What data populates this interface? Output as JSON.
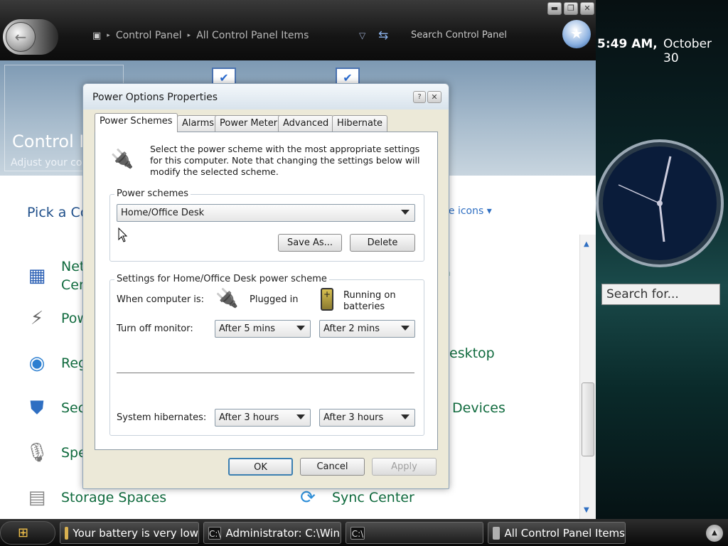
{
  "window": {
    "breadcrumb": [
      "Control Panel",
      "All Control Panel Items"
    ],
    "search_placeholder": "Search Control Panel",
    "banner_title": "Control P",
    "banner_subtitle": "Adjust your cor",
    "pick_title": "Pick a Co",
    "view_by": "ge icons ▾",
    "left_items": [
      "Net\nCen",
      "Pow",
      "Reg",
      "Sec",
      "Spe",
      "Storage Spaces"
    ],
    "left_items_display": {
      "net1": "Net",
      "net2": "Cen",
      "pow": "Pow",
      "reg": "Reg",
      "sec": "Sec",
      "spe": "Spe",
      "storage": "Storage Spaces"
    },
    "right_items": {
      "desktop": "esktop",
      "devices": "Devices",
      "sync": "Sync Center",
      "partial": "a"
    },
    "controls": {
      "minimize": "▬",
      "restore": "❐",
      "close": "✕"
    }
  },
  "sidebar": {
    "time": "5:49 AM,",
    "date": "October 30",
    "search_placeholder": "Search for..."
  },
  "dialog": {
    "title": "Power Options Properties",
    "help": "?",
    "close": "✕",
    "tabs": [
      "Power Schemes",
      "Alarms",
      "Power Meter",
      "Advanced",
      "Hibernate"
    ],
    "active_tab": "Power Schemes",
    "intro": "Select the power scheme with the most appropriate settings for this computer. Note that changing the settings below will modify the selected scheme.",
    "power_schemes_label": "Power schemes",
    "selected_scheme": "Home/Office Desk",
    "save_as": "Save As...",
    "delete": "Delete",
    "settings_label": "Settings for Home/Office Desk power scheme",
    "when_computer_is": "When computer is:",
    "plugged_in": "Plugged in",
    "on_batteries": "Running on batteries",
    "turn_off_monitor": "Turn off monitor:",
    "monitor_plugged": "After 5 mins",
    "monitor_battery": "After 2 mins",
    "system_hibernates": "System hibernates:",
    "hibernate_plugged": "After 3 hours",
    "hibernate_battery": "After 3 hours",
    "ok": "OK",
    "cancel": "Cancel",
    "apply": "Apply"
  },
  "taskbar": {
    "items": [
      "Your battery is very low",
      "Administrator: C:\\Win...",
      "",
      "All Control Panel Items"
    ],
    "start_icon": "windows-logo"
  },
  "colors": {
    "link_green": "#0f6a3d",
    "link_blue": "#2f6fc2",
    "dialog_bg": "#ece9d8"
  }
}
